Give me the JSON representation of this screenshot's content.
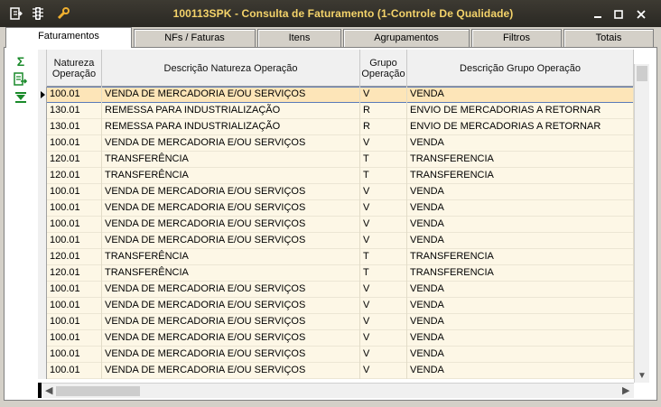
{
  "window": {
    "title": "100113SPK - Consulta de Faturamento (1-Controle De Qualidade)",
    "minimize_glyph": "▬",
    "restore_glyph": "□",
    "close_glyph": "✕"
  },
  "toolbar_icons": [
    "menu-icon",
    "traffic-light-icon",
    "wrench-icon"
  ],
  "tabs": [
    {
      "label": "Faturamentos",
      "active": true
    },
    {
      "label": "NFs / Faturas",
      "active": false
    },
    {
      "label": "Itens",
      "active": false
    },
    {
      "label": "Agrupamentos",
      "active": false
    },
    {
      "label": "Filtros",
      "active": false
    },
    {
      "label": "Totais",
      "active": false
    }
  ],
  "side_tools": {
    "sum": "Σ",
    "export": "⇨",
    "expand": "⏷"
  },
  "grid": {
    "headers": [
      "Natureza Operação",
      "Descrição Natureza Operação",
      "Grupo Operação",
      "Descrição Grupo Operação"
    ],
    "rows": [
      [
        "100.01",
        "VENDA DE MERCADORIA E/OU SERVIÇOS",
        "V",
        "VENDA"
      ],
      [
        "130.01",
        "REMESSA PARA INDUSTRIALIZAÇÃO",
        "R",
        "ENVIO DE MERCADORIAS A RETORNAR"
      ],
      [
        "130.01",
        "REMESSA PARA INDUSTRIALIZAÇÃO",
        "R",
        "ENVIO DE MERCADORIAS A RETORNAR"
      ],
      [
        "100.01",
        "VENDA DE MERCADORIA E/OU SERVIÇOS",
        "V",
        "VENDA"
      ],
      [
        "120.01",
        "TRANSFERÊNCIA",
        "T",
        "TRANSFERENCIA"
      ],
      [
        "120.01",
        "TRANSFERÊNCIA",
        "T",
        "TRANSFERENCIA"
      ],
      [
        "100.01",
        "VENDA DE MERCADORIA E/OU SERVIÇOS",
        "V",
        "VENDA"
      ],
      [
        "100.01",
        "VENDA DE MERCADORIA E/OU SERVIÇOS",
        "V",
        "VENDA"
      ],
      [
        "100.01",
        "VENDA DE MERCADORIA E/OU SERVIÇOS",
        "V",
        "VENDA"
      ],
      [
        "100.01",
        "VENDA DE MERCADORIA E/OU SERVIÇOS",
        "V",
        "VENDA"
      ],
      [
        "120.01",
        "TRANSFERÊNCIA",
        "T",
        "TRANSFERENCIA"
      ],
      [
        "120.01",
        "TRANSFERÊNCIA",
        "T",
        "TRANSFERENCIA"
      ],
      [
        "100.01",
        "VENDA DE MERCADORIA E/OU SERVIÇOS",
        "V",
        "VENDA"
      ],
      [
        "100.01",
        "VENDA DE MERCADORIA E/OU SERVIÇOS",
        "V",
        "VENDA"
      ],
      [
        "100.01",
        "VENDA DE MERCADORIA E/OU SERVIÇOS",
        "V",
        "VENDA"
      ],
      [
        "100.01",
        "VENDA DE MERCADORIA E/OU SERVIÇOS",
        "V",
        "VENDA"
      ],
      [
        "100.01",
        "VENDA DE MERCADORIA E/OU SERVIÇOS",
        "V",
        "VENDA"
      ],
      [
        "100.01",
        "VENDA DE MERCADORIA E/OU SERVIÇOS",
        "V",
        "VENDA"
      ]
    ],
    "selected_row": 0
  },
  "colors": {
    "title_bg": "#2f2d27",
    "title_text": "#f4d36a",
    "row_bg": "#fdf7e6",
    "selected_row_bg": "#fde5b8"
  }
}
